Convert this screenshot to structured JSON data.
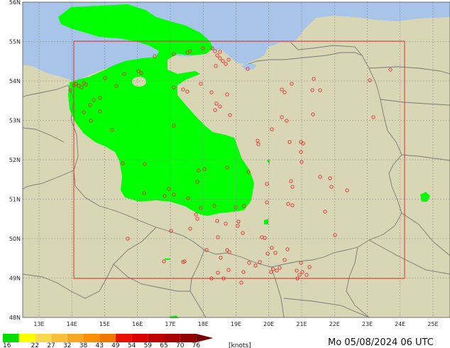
{
  "map": {
    "latitude_labels": [
      "56N",
      "55N",
      "54N",
      "53N",
      "52N",
      "51N",
      "50N",
      "49N",
      "48N"
    ],
    "longitude_labels": [
      "13E",
      "14E",
      "15E",
      "16E",
      "17E",
      "18E",
      "19E",
      "20E",
      "21E",
      "22E",
      "23E",
      "24E",
      "25E"
    ],
    "colors": {
      "land": "#d8d6b4",
      "sea": "#a8c4e8",
      "wind_area": "#00ff00",
      "border": "#7a7a7a",
      "grid": "#8a8a8a",
      "domain_box": "#e03030",
      "station": "#e03030"
    },
    "stations": [
      [
        107,
        118
      ],
      [
        111,
        121
      ],
      [
        115,
        123
      ],
      [
        118,
        117
      ],
      [
        121,
        119
      ],
      [
        99,
        127
      ],
      [
        104,
        120
      ],
      [
        148,
        110
      ],
      [
        175,
        104
      ],
      [
        195,
        100
      ],
      [
        199,
        103
      ],
      [
        218,
        79
      ],
      [
        245,
        76
      ],
      [
        264,
        74
      ],
      [
        268,
        72
      ],
      [
        286,
        68
      ],
      [
        299,
        68
      ],
      [
        303,
        72
      ],
      [
        306,
        78
      ],
      [
        310,
        82
      ],
      [
        314,
        86
      ],
      [
        318,
        90
      ],
      [
        322,
        84
      ],
      [
        349,
        97
      ],
      [
        304,
        93
      ],
      [
        310,
        73
      ],
      [
        141,
        138
      ],
      [
        132,
        141
      ],
      [
        127,
        148
      ],
      [
        141,
        157
      ],
      [
        128,
        170
      ],
      [
        118,
        158
      ],
      [
        158,
        183
      ],
      [
        173,
        230
      ],
      [
        203,
        272
      ],
      [
        232,
        276
      ],
      [
        245,
        274
      ],
      [
        258,
        126
      ],
      [
        264,
        129
      ],
      [
        245,
        177
      ],
      [
        283,
        118
      ],
      [
        298,
        130
      ],
      [
        305,
        146
      ],
      [
        310,
        150
      ],
      [
        303,
        155
      ],
      [
        320,
        133
      ],
      [
        324,
        162
      ],
      [
        280,
        240
      ],
      [
        288,
        238
      ],
      [
        278,
        256
      ],
      [
        265,
        279
      ],
      [
        283,
        293
      ],
      [
        276,
        302
      ],
      [
        278,
        308
      ],
      [
        320,
        236
      ],
      [
        350,
        242
      ],
      [
        344,
        290
      ],
      [
        332,
        292
      ],
      [
        302,
        290
      ],
      [
        306,
        311
      ],
      [
        318,
        315
      ],
      [
        336,
        312
      ],
      [
        335,
        318
      ],
      [
        342,
        328
      ],
      [
        363,
        198
      ],
      [
        364,
        203
      ],
      [
        376,
        259
      ],
      [
        376,
        285
      ],
      [
        397,
        126
      ],
      [
        401,
        130
      ],
      [
        411,
        118
      ],
      [
        397,
        165
      ],
      [
        404,
        170
      ],
      [
        383,
        182
      ],
      [
        408,
        200
      ],
      [
        424,
        200
      ],
      [
        427,
        202
      ],
      [
        424,
        214
      ],
      [
        425,
        228
      ],
      [
        410,
        255
      ],
      [
        412,
        263
      ],
      [
        406,
        287
      ],
      [
        412,
        289
      ],
      [
        440,
        127
      ],
      [
        442,
        111
      ],
      [
        451,
        127
      ],
      [
        441,
        161
      ],
      [
        451,
        249
      ],
      [
        465,
        251
      ],
      [
        467,
        263
      ],
      [
        489,
        268
      ],
      [
        458,
        298
      ],
      [
        472,
        331
      ],
      [
        521,
        113
      ],
      [
        550,
        98
      ],
      [
        526,
        165
      ],
      [
        180,
        336
      ],
      [
        241,
        325
      ],
      [
        268,
        322
      ],
      [
        307,
        334
      ],
      [
        291,
        352
      ],
      [
        320,
        352
      ],
      [
        323,
        355
      ],
      [
        311,
        363
      ],
      [
        260,
        368
      ],
      [
        258,
        369
      ],
      [
        231,
        368
      ],
      [
        369,
        334
      ],
      [
        373,
        335
      ],
      [
        383,
        349
      ],
      [
        388,
        356
      ],
      [
        405,
        351
      ],
      [
        377,
        357
      ],
      [
        351,
        370
      ],
      [
        366,
        369
      ],
      [
        360,
        374
      ],
      [
        307,
        384
      ],
      [
        322,
        380
      ],
      [
        315,
        392
      ],
      [
        385,
        379
      ],
      [
        390,
        381
      ],
      [
        394,
        377
      ],
      [
        401,
        366
      ],
      [
        382,
        383
      ],
      [
        424,
        370
      ],
      [
        418,
        381
      ],
      [
        426,
        383
      ],
      [
        422,
        387
      ],
      [
        436,
        376
      ],
      [
        432,
        387
      ],
      [
        419,
        392
      ],
      [
        298,
        392
      ],
      [
        340,
        398
      ],
      [
        343,
        383
      ],
      [
        238,
        266
      ],
      [
        204,
        231
      ],
      [
        245,
        123
      ],
      [
        164,
        121
      ]
    ]
  },
  "legend": {
    "labels": [
      "16",
      "22",
      "27",
      "32",
      "38",
      "43",
      "49",
      "54",
      "59",
      "65",
      "70",
      "76"
    ],
    "unit": "[knots]",
    "colors": [
      "#00dd00",
      "#ffff00",
      "#f8d84c",
      "#f8c038",
      "#f8a820",
      "#f89000",
      "#f07800",
      "#e81000",
      "#d80000",
      "#c00000",
      "#a80000",
      "#900000",
      "#780000"
    ]
  },
  "timestamp": "Mo 05/08/2024 06 UTC"
}
